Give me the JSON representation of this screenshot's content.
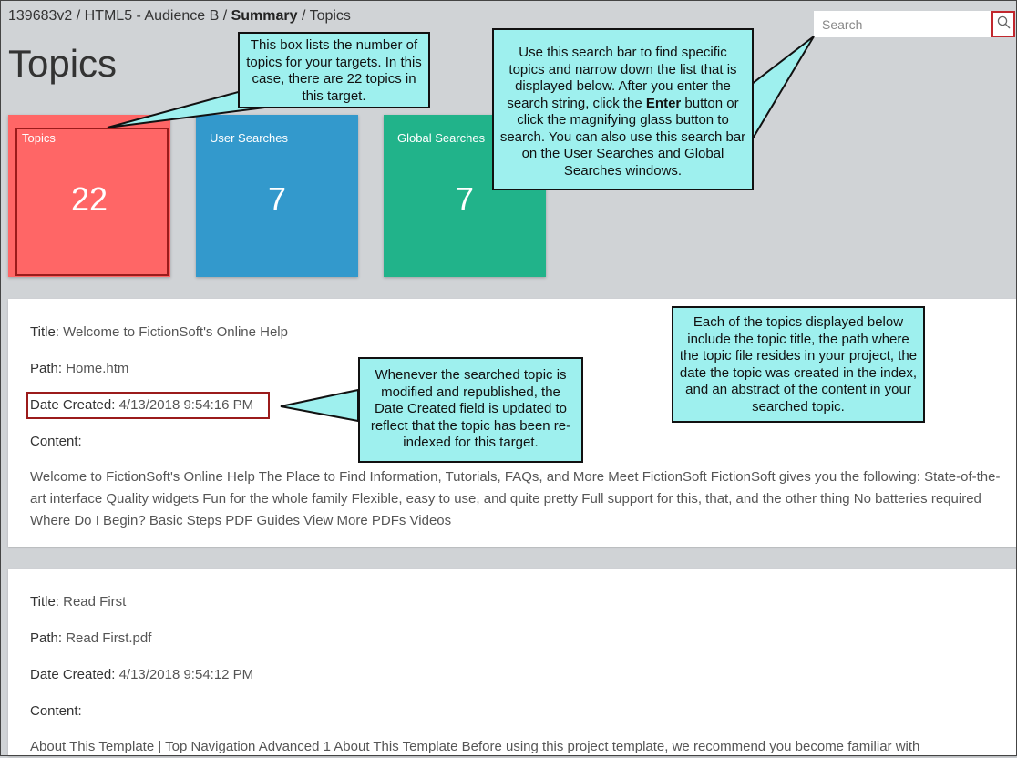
{
  "breadcrumb": {
    "part1": "139683v2",
    "sep1": " / ",
    "part2": "HTML5 - Audience B",
    "sep2": " / ",
    "part3": "Summary",
    "sep3": " / ",
    "part4": "Topics"
  },
  "page_title": "Topics",
  "search": {
    "placeholder": "Search",
    "value": ""
  },
  "cards": [
    {
      "label": "Topics",
      "count": "22",
      "color": "#ff6666"
    },
    {
      "label": "User Searches",
      "count": "7",
      "color": "#3399cc"
    },
    {
      "label": "Global Searches",
      "count": "7",
      "color": "#21b38a"
    }
  ],
  "results": [
    {
      "title_key": "Title:",
      "title": "Welcome to FictionSoft's Online Help",
      "path_key": "Path:",
      "path": "Home.htm",
      "date_key": "Date Created:",
      "date": "4/13/2018 9:54:16 PM",
      "content_key": "Content:",
      "content": "Welcome to FictionSoft's Online Help The Place to Find Information, Tutorials, FAQs, and More Meet FictionSoft FictionSoft gives you the following: State-of-the-art interface Quality widgets Fun for the whole family Flexible, easy to use, and quite pretty Full support for this, that, and the other thing No batteries required Where Do I Begin? Basic Steps PDF Guides View More PDFs Videos"
    },
    {
      "title_key": "Title:",
      "title": "Read First",
      "path_key": "Path:",
      "path": "Read First.pdf",
      "date_key": "Date Created:",
      "date": "4/13/2018 9:54:12 PM",
      "content_key": "Content:",
      "content": "About This Template | Top Navigation Advanced 1 About This Template Before using this project template, we recommend you become familiar with"
    }
  ],
  "callouts": {
    "topics_box": "This box lists the number of topics for your targets.  In this case, there are 22 topics in this target.",
    "search_bar_a": "Use this search bar to find specific topics and narrow down the list that is displayed below. After you enter the search string, click the ",
    "search_bar_bold": "Enter",
    "search_bar_b": " button or click the magnifying glass button to search. You can also use this search bar on the User Searches and Global Searches windows.",
    "date_created": "Whenever the searched topic is modified and republished, the Date Created field is updated to reflect that the topic has been re-indexed for this target.",
    "topics_displayed": "Each of the topics displayed below include the topic title, the path where the topic file resides in your project, the date the topic was created in the index, and an abstract of the content in your searched topic."
  },
  "colors": {
    "callout_fill": "#9ef0ee",
    "highlight_border": "#9b1b1b",
    "page_bg": "#d0d3d6"
  }
}
